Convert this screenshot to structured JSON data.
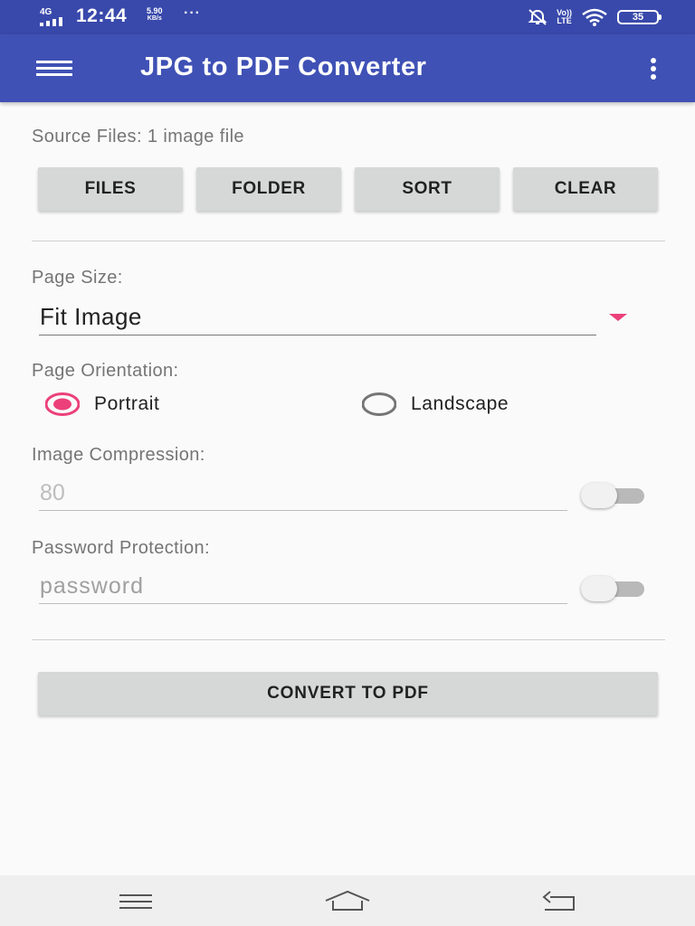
{
  "status_bar": {
    "network": "4G",
    "time": "12:44",
    "speed_value": "5.90",
    "speed_unit": "KB/s",
    "more": "···",
    "volte_top": "Vo))",
    "volte_bottom": "LTE",
    "battery": "35",
    "icons": [
      "signal-icon",
      "mute-icon",
      "wifi-icon",
      "battery-icon"
    ]
  },
  "app_bar": {
    "title": "JPG to PDF Converter",
    "icons": [
      "hamburger-menu-icon",
      "more-vert-icon"
    ]
  },
  "source": {
    "label": "Source Files: 1 image file",
    "buttons": {
      "files": "FILES",
      "folder": "FOLDER",
      "sort": "SORT",
      "clear": "CLEAR"
    }
  },
  "page_size": {
    "label": "Page Size:",
    "value": "Fit Image"
  },
  "orientation": {
    "label": "Page Orientation:",
    "options": [
      {
        "label": "Portrait",
        "selected": true
      },
      {
        "label": "Landscape",
        "selected": false
      }
    ]
  },
  "compression": {
    "label": "Image Compression:",
    "value": "80",
    "enabled": false
  },
  "password": {
    "label": "Password Protection:",
    "placeholder": "password",
    "enabled": false
  },
  "convert_button": "CONVERT TO PDF",
  "nav_bar": {
    "icons": [
      "recents-icon",
      "home-icon",
      "back-icon"
    ]
  },
  "colors": {
    "status_bar": "#3949ab",
    "app_bar": "#3f51b5",
    "accent": "#ec407a",
    "button": "#d6d7d7",
    "background": "#fafafa"
  }
}
